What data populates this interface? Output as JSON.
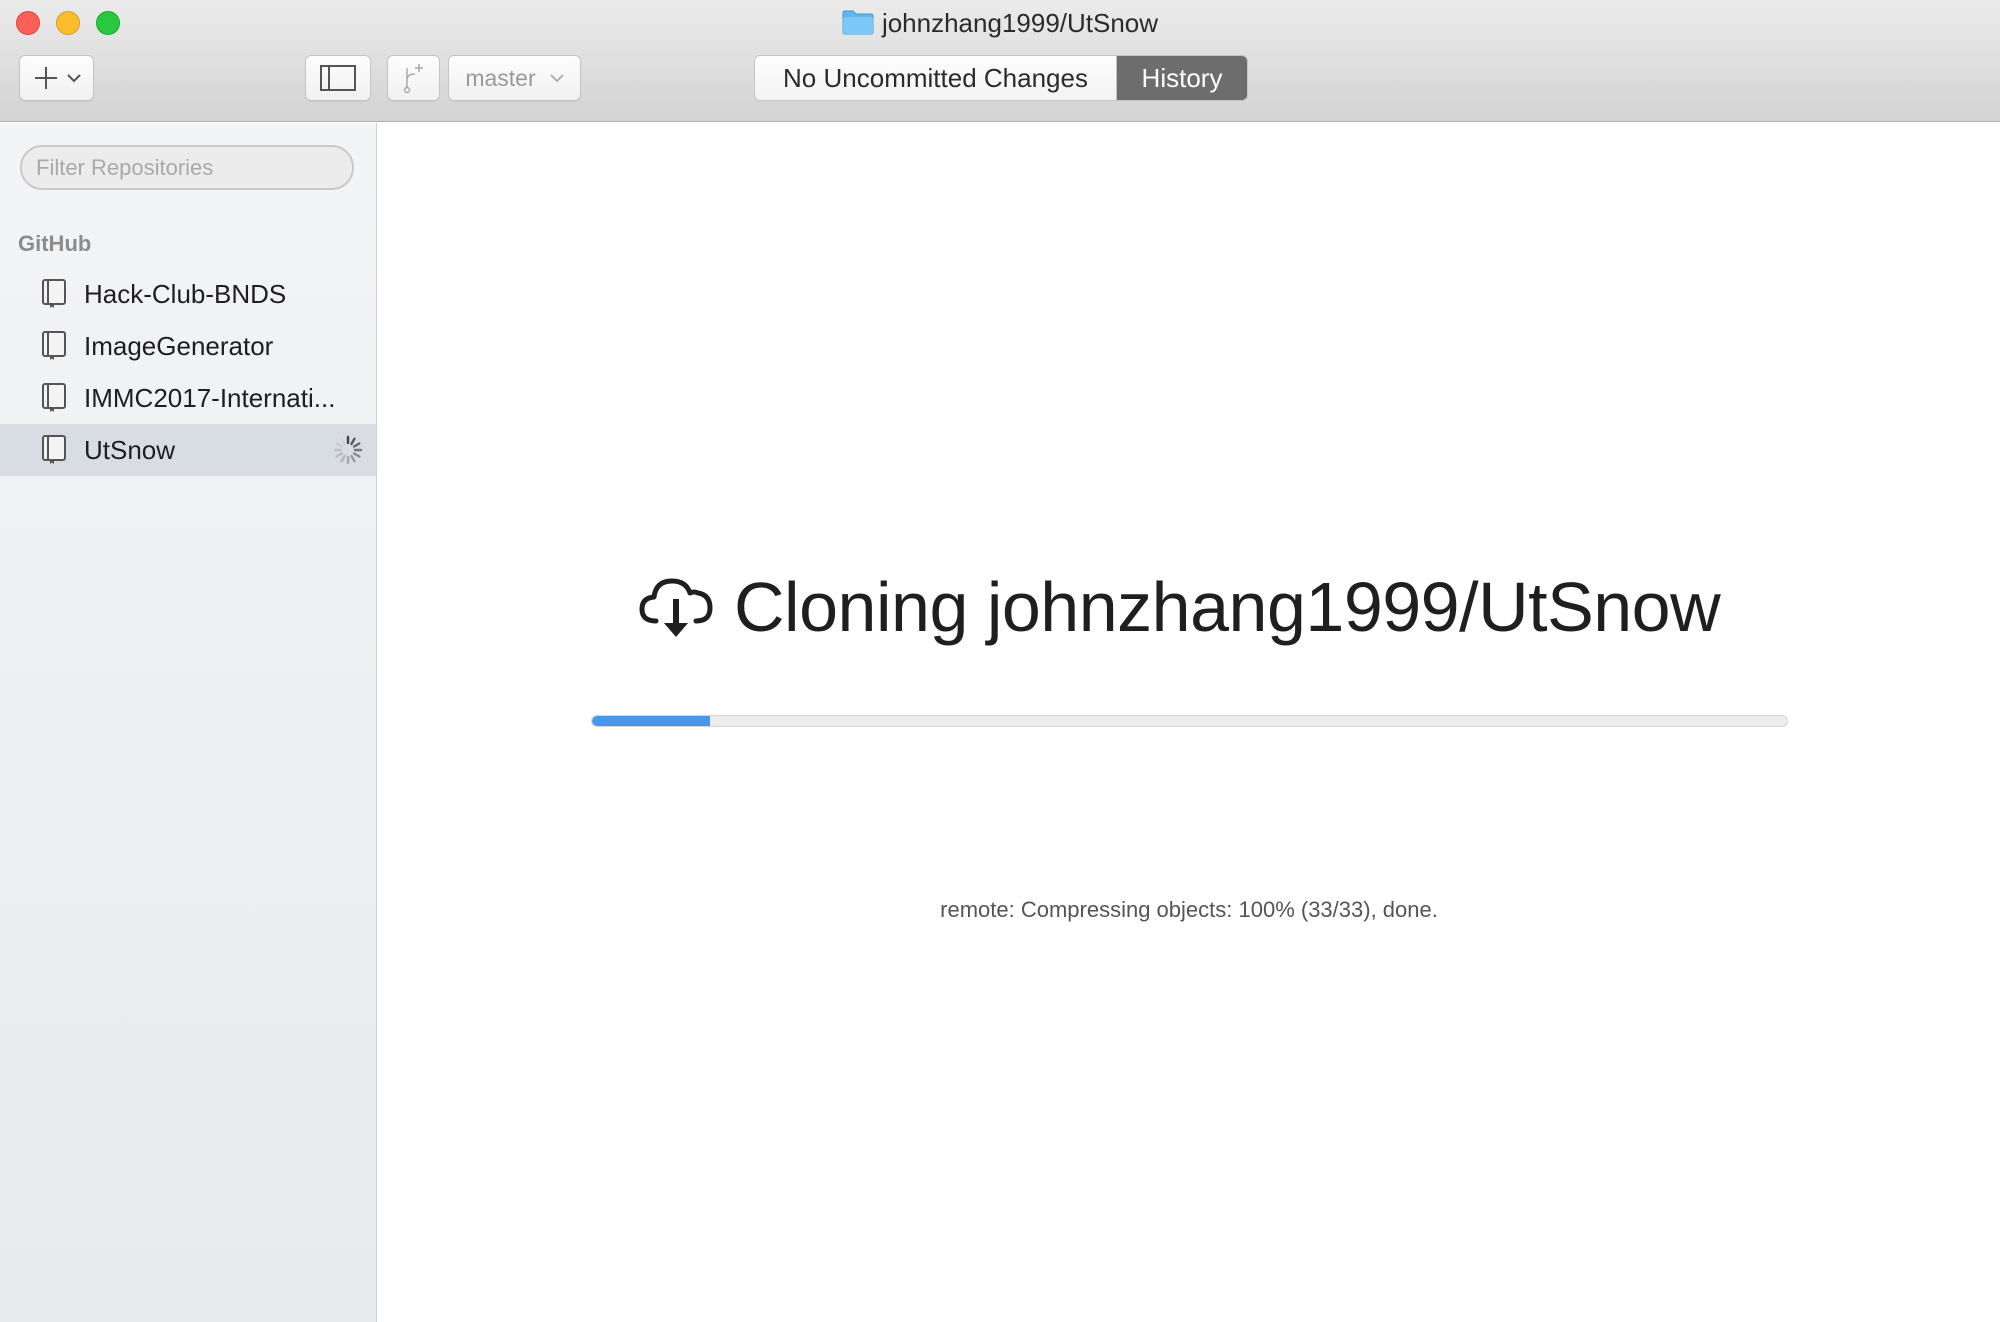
{
  "window": {
    "title": "johnzhang1999/UtSnow"
  },
  "toolbar": {
    "add_icon": "plus-icon",
    "sidebar_toggle_icon": "sidebar-icon",
    "branch_icon": "branch-icon",
    "branch_name": "master",
    "segments": [
      {
        "label": "No Uncommitted Changes",
        "selected": false
      },
      {
        "label": "History",
        "selected": true
      }
    ]
  },
  "sidebar": {
    "filter_placeholder": "Filter Repositories",
    "section": "GitHub",
    "repos": [
      {
        "label": "Hack-Club-BNDS",
        "selected": false
      },
      {
        "label": "ImageGenerator",
        "selected": false
      },
      {
        "label": "IMMC2017-Internati...",
        "selected": false
      },
      {
        "label": "UtSnow",
        "selected": true,
        "loading": true
      }
    ]
  },
  "main": {
    "heading": "Cloning johnzhang1999/UtSnow",
    "heading_icon": "cloud-download-icon",
    "progress": 0.099,
    "status": "remote: Compressing objects: 100% (33/33), done."
  },
  "colors": {
    "accent": "#4a97ea",
    "selected_segment": "#6d6d6d",
    "selected_row": "#d8dce3"
  }
}
